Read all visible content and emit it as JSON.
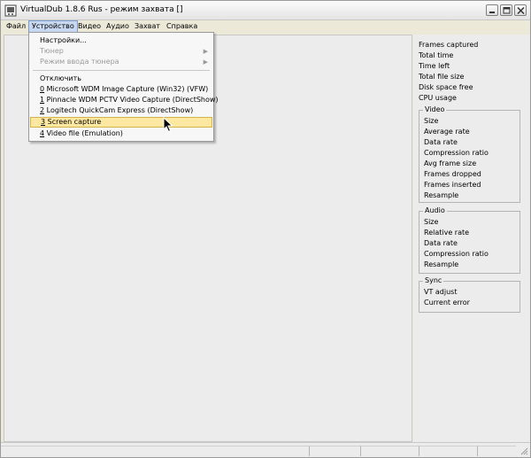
{
  "window": {
    "title": "VirtualDub 1.8.6 Rus - режим захвата []",
    "app_icon": "virtualdub-icon"
  },
  "menubar": {
    "items": [
      {
        "label": "Файл"
      },
      {
        "label": "Устройство",
        "active": true
      },
      {
        "label": "Видео"
      },
      {
        "label": "Аудио"
      },
      {
        "label": "Захват"
      },
      {
        "label": "Справка"
      }
    ]
  },
  "device_menu": {
    "settings": "Настройки...",
    "tuner": "Тюнер",
    "tuner_input_mode": "Режим ввода тюнера",
    "disconnect": "Отключить",
    "devices": [
      {
        "key": "0",
        "rest": " Microsoft WDM Image Capture (Win32) (VFW)"
      },
      {
        "key": "1",
        "rest": " Pinnacle WDM PCTV Video Capture (DirectShow)"
      },
      {
        "key": "2",
        "rest": " Logitech QuickCam Express (DirectShow)"
      },
      {
        "key": "3",
        "rest": " Screen capture",
        "selected": true
      },
      {
        "key": "4",
        "rest": " Video file (Emulation)"
      }
    ]
  },
  "stats": {
    "general": [
      "Frames captured",
      "Total time",
      "Time left",
      "Total file size",
      "Disk space free",
      "CPU usage"
    ],
    "video": {
      "title": "Video",
      "items": [
        "Size",
        "Average rate",
        "Data rate",
        "Compression ratio",
        "Avg frame size",
        "Frames dropped",
        "Frames inserted",
        "Resample"
      ]
    },
    "audio": {
      "title": "Audio",
      "items": [
        "Size",
        "Relative rate",
        "Data rate",
        "Compression ratio",
        "Resample"
      ]
    },
    "sync": {
      "title": "Sync",
      "items": [
        "VT adjust",
        "Current error"
      ]
    }
  },
  "colors": {
    "menu_highlight": "#fce8a0",
    "active_menu": "#c8d8f0"
  }
}
